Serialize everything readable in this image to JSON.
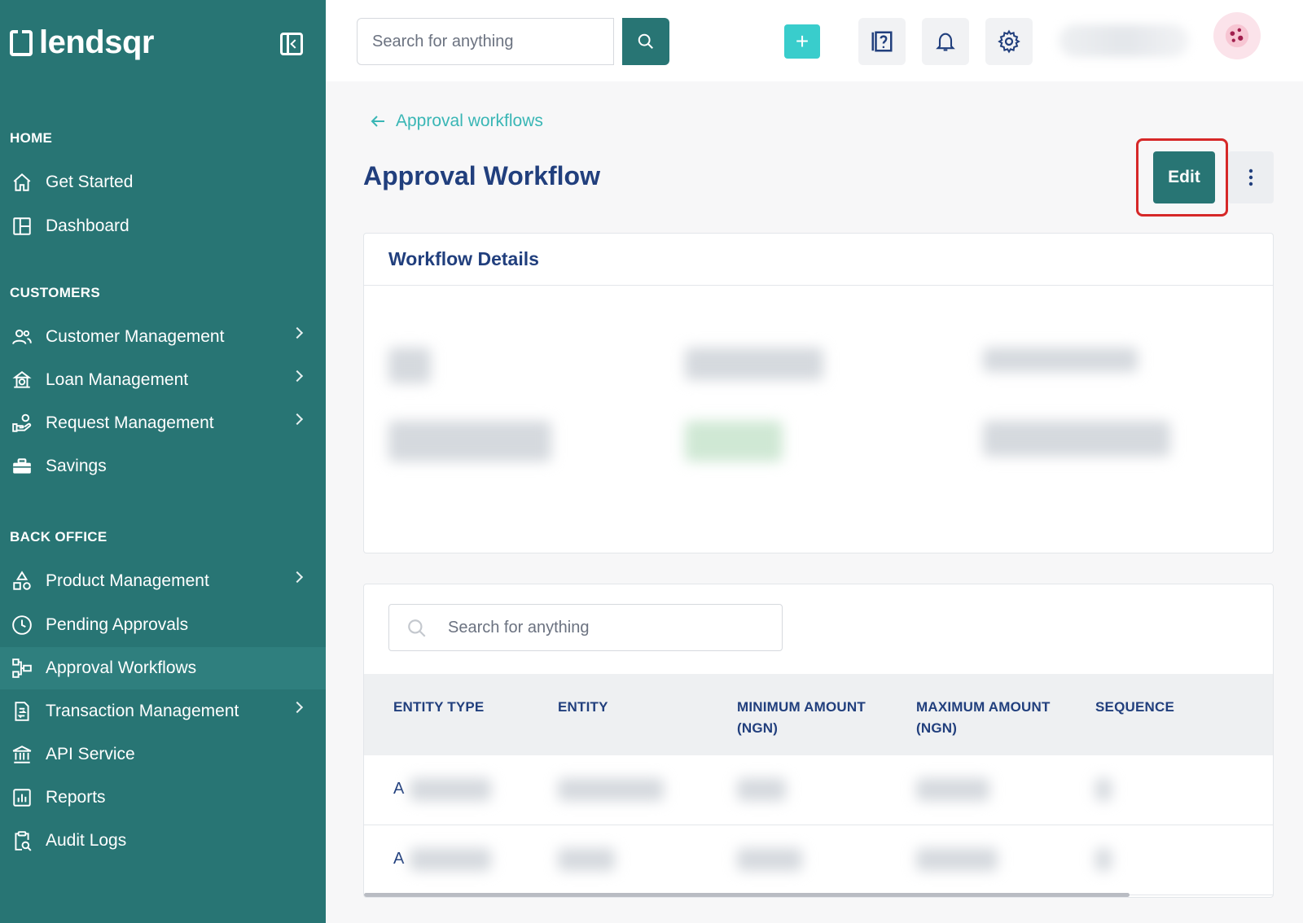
{
  "app": {
    "brand": "lendsqr"
  },
  "sidebar": {
    "sections": {
      "home": "HOME",
      "customers": "CUSTOMERS",
      "back_office": "BACK OFFICE"
    },
    "items": [
      {
        "label": "Get Started",
        "icon": "home-icon"
      },
      {
        "label": "Dashboard",
        "icon": "dashboard-icon"
      },
      {
        "label": "Customer Management",
        "icon": "users-icon",
        "has_submenu": true
      },
      {
        "label": "Loan Management",
        "icon": "loan-icon",
        "has_submenu": true
      },
      {
        "label": "Request Management",
        "icon": "request-icon",
        "has_submenu": true
      },
      {
        "label": "Savings",
        "icon": "briefcase-icon"
      },
      {
        "label": "Product Management",
        "icon": "shapes-icon",
        "has_submenu": true
      },
      {
        "label": "Pending Approvals",
        "icon": "clock-icon"
      },
      {
        "label": "Approval Workflows",
        "icon": "workflow-icon",
        "active": true
      },
      {
        "label": "Transaction Management",
        "icon": "transaction-icon",
        "has_submenu": true
      },
      {
        "label": "API Service",
        "icon": "bank-icon"
      },
      {
        "label": "Reports",
        "icon": "report-icon"
      },
      {
        "label": "Audit Logs",
        "icon": "audit-icon"
      }
    ]
  },
  "topbar": {
    "search_placeholder": "Search for anything",
    "add_label": "+"
  },
  "main": {
    "back_link": "Approval workflows",
    "title": "Approval Workflow",
    "edit_label": "Edit",
    "details_card": {
      "title": "Workflow Details"
    },
    "table": {
      "search_placeholder": "Search for anything",
      "columns": [
        "ENTITY TYPE",
        "ENTITY",
        "MINIMUM AMOUNT (NGN)",
        "MAXIMUM AMOUNT (NGN)",
        "SEQUENCE"
      ],
      "rows": [
        {
          "lead": "A"
        },
        {
          "lead": "A"
        }
      ]
    }
  },
  "colors": {
    "sidebar_bg": "#287574",
    "accent": "#39cdcc",
    "title": "#213f7d",
    "highlight": "#d62828"
  }
}
